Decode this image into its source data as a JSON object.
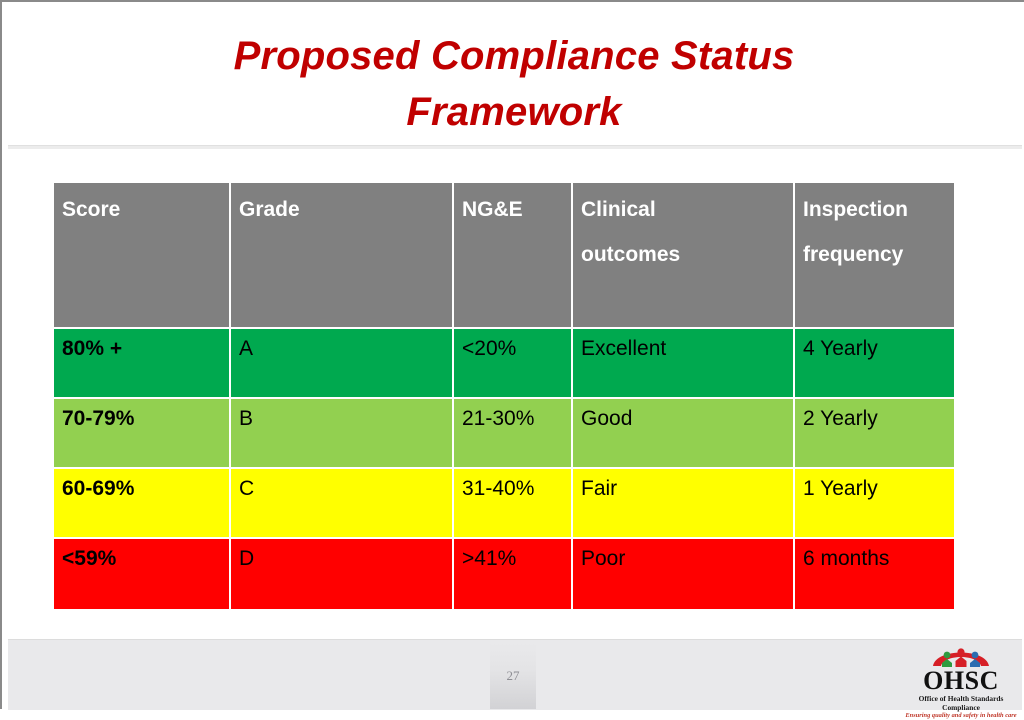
{
  "slide": {
    "title_lines": [
      "Proposed Compliance Status",
      "Framework"
    ],
    "title_color": "#C00000",
    "page_number": "27"
  },
  "table": {
    "headers": [
      {
        "lines": [
          "Score"
        ]
      },
      {
        "lines": [
          "Grade"
        ]
      },
      {
        "lines": [
          "NG&E"
        ]
      },
      {
        "lines": [
          "Clinical",
          "outcomes"
        ]
      },
      {
        "lines": [
          "Inspection",
          "frequency"
        ]
      }
    ],
    "header_bg": "#808080",
    "header_text_color": "#FFFFFF",
    "rows": [
      {
        "color": "#00A94F",
        "score": "80% +",
        "grade": "A",
        "ngande": "<20%",
        "clinical_outcomes": "Excellent",
        "inspection_frequency": "4 Yearly"
      },
      {
        "color": "#92D050",
        "score": "70-79%",
        "grade": "B",
        "ngande": "21-30%",
        "clinical_outcomes": "Good",
        "inspection_frequency": "2 Yearly"
      },
      {
        "color": "#FFFF00",
        "score": "60-69%",
        "grade": "C",
        "ngande": "31-40%",
        "clinical_outcomes": "Fair",
        "inspection_frequency": "1 Yearly"
      },
      {
        "color": "#FF0000",
        "score": "<59%",
        "grade": "D",
        "ngande": ">41%",
        "clinical_outcomes": "Poor",
        "inspection_frequency": "6 months"
      }
    ]
  },
  "logo": {
    "wordmark": "OHSC",
    "tagline": "Office of Health Standards Compliance",
    "subtagline": "Ensuring quality and safety in health care",
    "figure_colors": [
      "#2e9b3f",
      "#d61f26",
      "#2b6cb0"
    ],
    "arc_color": "#d61f26"
  }
}
